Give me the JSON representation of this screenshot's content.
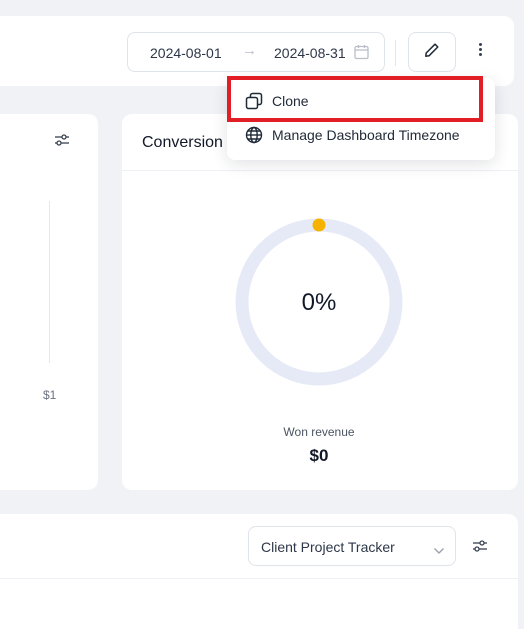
{
  "toolbar": {
    "date_start": "2024-08-01",
    "date_arrow": "→",
    "date_end": "2024-08-31",
    "icons": [
      "calendar-icon",
      "pencil-icon",
      "more-vertical-icon"
    ]
  },
  "menu": {
    "items": [
      {
        "label": "Clone",
        "icon": "clone-icon"
      },
      {
        "label": "Manage Dashboard Timezone",
        "icon": "globe-icon"
      }
    ]
  },
  "left_widget": {
    "axis_label": "$1",
    "icon": "filter-settings-icon"
  },
  "conversion_widget": {
    "title": "Conversion",
    "percent_text": "0%",
    "percent_value": 0,
    "won_revenue_label": "Won revenue",
    "won_revenue_value": "$0"
  },
  "bottom_widget": {
    "selected_pipeline": "Client Project Tracker",
    "icons": [
      "chevron-down-icon",
      "filter-settings-icon"
    ]
  },
  "colors": {
    "background": "#f0f2f6",
    "ring_track": "#e5eaf6",
    "ring_indicator": "#f5b300",
    "highlight": "#e11d26"
  }
}
